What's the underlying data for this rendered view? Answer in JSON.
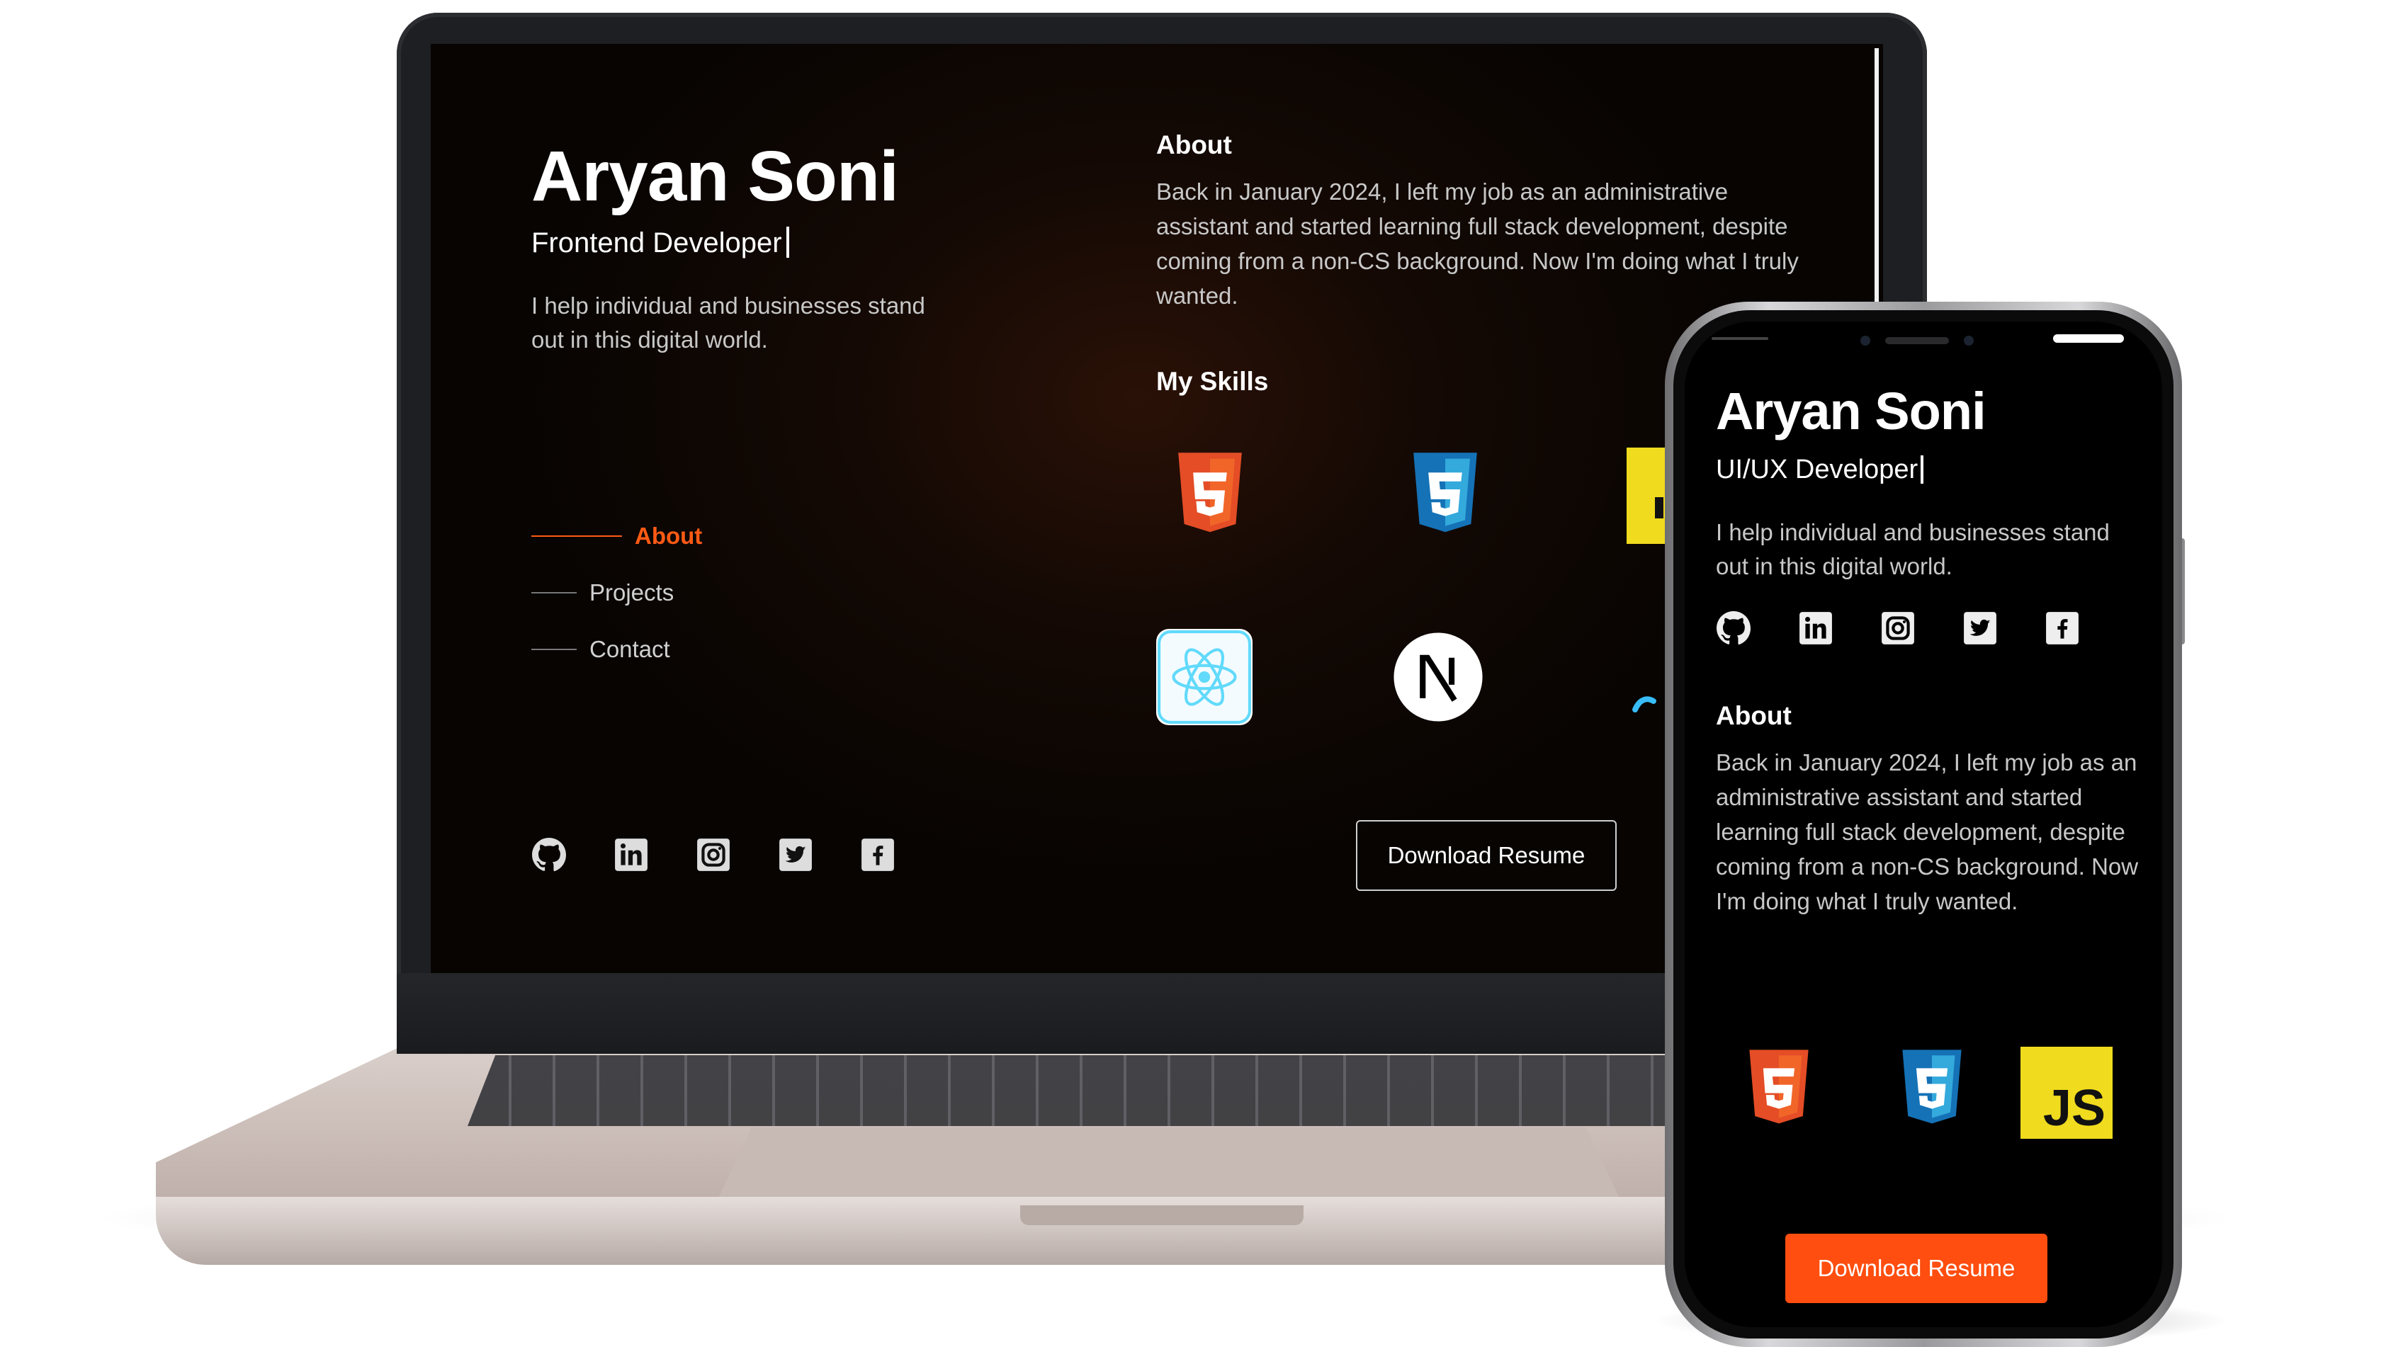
{
  "desktop": {
    "name": "Aryan Soni",
    "role": "Frontend Developer",
    "tagline": "I help individual and businesses stand out in this digital world.",
    "nav": [
      {
        "label": "About",
        "active": true
      },
      {
        "label": "Projects",
        "active": false
      },
      {
        "label": "Contact",
        "active": false
      }
    ],
    "about_heading": "About",
    "about_text": "Back in January 2024, I left my job as an administrative assistant and started learning full stack development, despite coming from a non-CS background. Now I'm doing what I truly wanted.",
    "skills_heading": "My Skills",
    "skills": [
      "html5-icon",
      "css3-icon",
      "javascript-icon",
      "react-icon",
      "nextjs-icon",
      "tailwind-icon"
    ],
    "download_label": "Download Resume"
  },
  "mobile": {
    "name": "Aryan Soni",
    "role": "UI/UX Developer",
    "tagline": "I help individual and businesses stand out in this digital world.",
    "about_heading": "About",
    "about_text": "Back in January 2024, I left my job as an administrative assistant and started learning full stack development, despite coming from a non-CS background. Now I'm doing what I truly wanted.",
    "skills": [
      "html5-icon",
      "css3-icon",
      "javascript-icon"
    ],
    "js_label": "JS",
    "download_label": "Download Resume"
  },
  "social": [
    "github-icon",
    "linkedin-icon",
    "instagram-icon",
    "twitter-icon",
    "facebook-icon"
  ],
  "colors": {
    "accent": "#ff4e0f",
    "nav_active": "#ff5a14",
    "html5": "#e44d26",
    "css3": "#1572b6",
    "javascript": "#f0db1e",
    "react": "#61dafb"
  }
}
